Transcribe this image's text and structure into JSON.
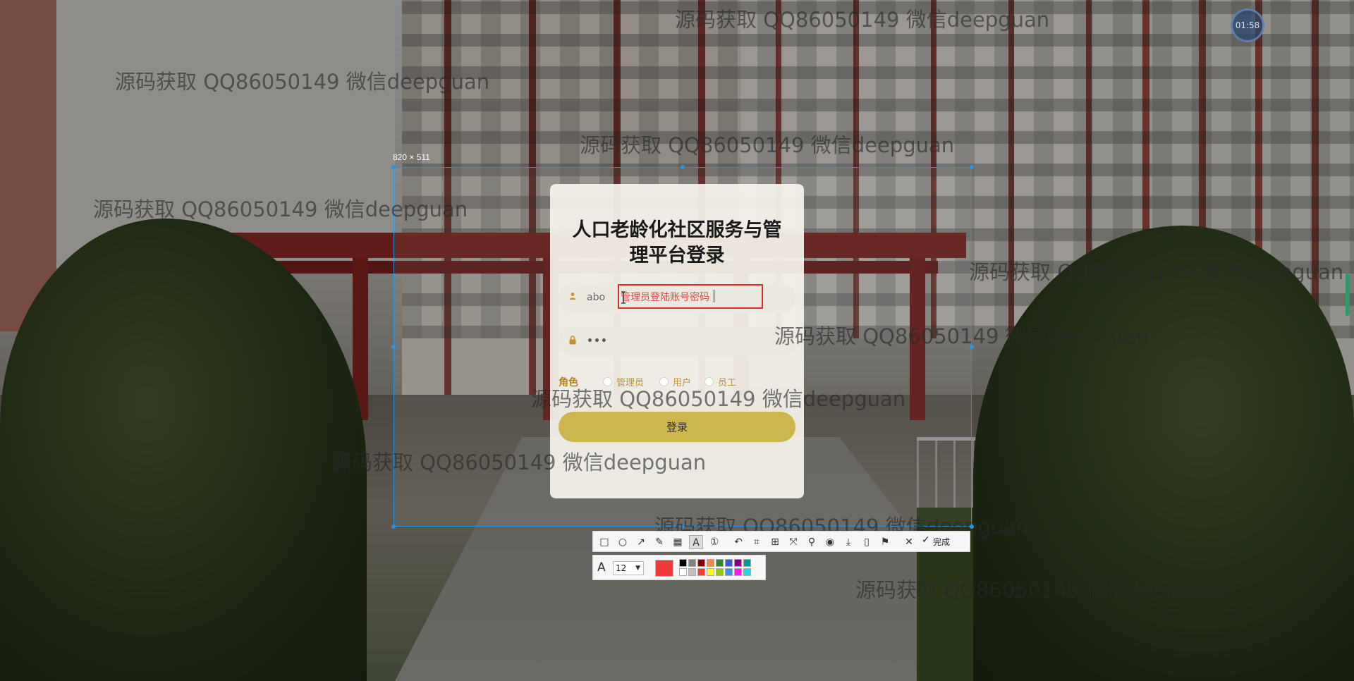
{
  "selection": {
    "size_label": "820 × 511"
  },
  "login": {
    "title": "人口老龄化社区服务与管理平台登录",
    "username_value": "abo",
    "password_value": "•••",
    "role_label": "角色",
    "roles": [
      "管理员",
      "用户",
      "员工"
    ],
    "submit_label": "登录",
    "annotation_text": "管理员登陆账号密码"
  },
  "toolbar": {
    "done_label": "完成",
    "font_size": "12",
    "current_color": "#ef3a3a",
    "palette": [
      "#000000",
      "#808080",
      "#800000",
      "#f7883a",
      "#308430",
      "#385ad3",
      "#800080",
      "#009999",
      "#ffffff",
      "#c0c0c0",
      "#fb3838",
      "#ffff00",
      "#99cc00",
      "#3894e4",
      "#f31bf3",
      "#16dcdc"
    ]
  },
  "watermark_text": "源码获取 QQ86050149 微信deepguan",
  "clock": {
    "time": "01:58"
  }
}
